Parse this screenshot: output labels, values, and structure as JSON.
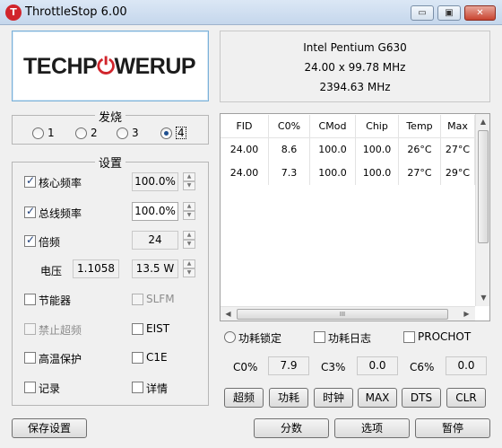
{
  "window": {
    "title": "ThrottleStop 6.00",
    "app_icon": "T",
    "min_glyph": "▭",
    "max_glyph": "▣",
    "close_glyph": "✕"
  },
  "logo": {
    "part1": "TECHP",
    "part2": "⏻",
    "part3": "WERUP"
  },
  "cpu": {
    "name": "Intel Pentium G630",
    "multiplier_bclk": "24.00 x 99.78 MHz",
    "freq": "2394.63 MHz"
  },
  "profile": {
    "group_title": "发烧",
    "options": [
      "1",
      "2",
      "3",
      "4"
    ],
    "selected": "4"
  },
  "settings": {
    "group_title": "设置",
    "core_freq": {
      "label": "核心频率",
      "value": "100.0%"
    },
    "bus_freq": {
      "label": "总线频率",
      "value": "100.0%"
    },
    "multiplier": {
      "label": "倍频",
      "value": "24"
    },
    "voltage": {
      "label": "电压",
      "value": "1.1058",
      "watts": "13.5 W"
    },
    "power_saver": "节能器",
    "slfm": "SLFM",
    "disable_turbo": "禁止超频",
    "eist": "EIST",
    "bd_prochot": "高温保护",
    "c1e": "C1E",
    "log": "记录",
    "more": "详情"
  },
  "table": {
    "columns": [
      "FID",
      "C0%",
      "CMod",
      "Chip",
      "Temp",
      "Max"
    ],
    "rows": [
      [
        "24.00",
        "8.6",
        "100.0",
        "100.0",
        "26°C",
        "27°C"
      ],
      [
        "24.00",
        "7.3",
        "100.0",
        "100.0",
        "27°C",
        "29°C"
      ]
    ],
    "scroll_mid": "III"
  },
  "options_row": {
    "power_lock": "功耗锁定",
    "power_log": "功耗日志",
    "prochot": "PROCHOT"
  },
  "cstates": {
    "c0_label": "C0%",
    "c0_val": "7.9",
    "c3_label": "C3%",
    "c3_val": "0.0",
    "c6_label": "C6%",
    "c6_val": "0.0"
  },
  "actions": {
    "turbo": "超频",
    "power": "功耗",
    "clock": "时钟",
    "max": "MAX",
    "dts": "DTS",
    "clr": "CLR"
  },
  "bottom": {
    "save": "保存设置",
    "score": "分数",
    "options": "选项",
    "pause": "暂停"
  }
}
